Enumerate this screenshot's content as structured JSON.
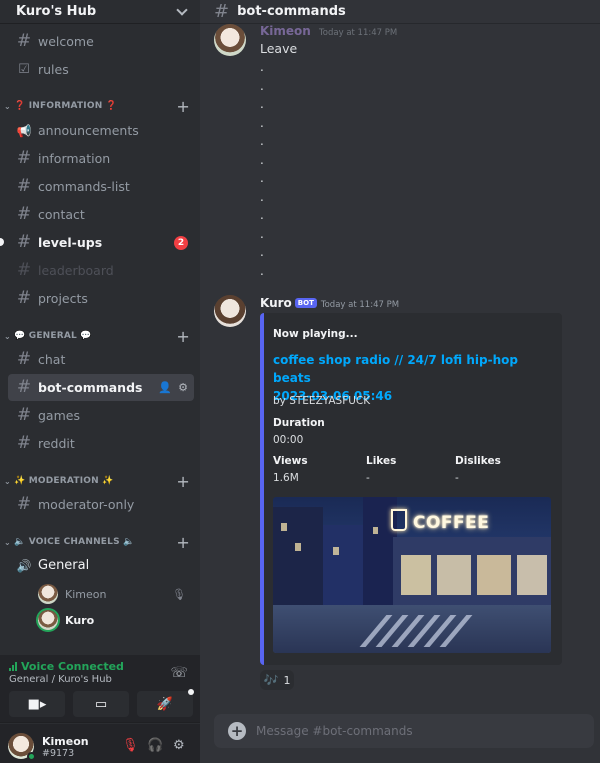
{
  "server": {
    "name": "Kuro's Hub"
  },
  "sidebar": {
    "top_channels": [
      {
        "label": "welcome"
      },
      {
        "label": "rules"
      }
    ],
    "categories": {
      "information": "❓ INFORMATION ❓",
      "general": "💬 GENERAL 💬",
      "moderation": "✨ MODERATION ✨",
      "voice": "🔈 VOICE CHANNELS 🔈"
    },
    "info_channels": [
      {
        "label": "announcements"
      },
      {
        "label": "information"
      },
      {
        "label": "commands-list"
      },
      {
        "label": "contact"
      },
      {
        "label": "level-ups",
        "badge": "2"
      },
      {
        "label": "leaderboard"
      },
      {
        "label": "projects"
      }
    ],
    "general_channels": [
      {
        "label": "chat"
      },
      {
        "label": "bot-commands"
      },
      {
        "label": "games"
      },
      {
        "label": "reddit"
      }
    ],
    "moderation_channels": [
      {
        "label": "moderator-only"
      }
    ],
    "voice_channel": {
      "label": "General"
    },
    "voice_users": [
      {
        "name": "Kimeon"
      },
      {
        "name": "Kuro"
      }
    ]
  },
  "voice_panel": {
    "status": "Voice Connected",
    "location": "General / Kuro's Hub"
  },
  "user_panel": {
    "name": "Kimeon",
    "tag": "#9173"
  },
  "channel": {
    "name": "bot-commands"
  },
  "messages": {
    "first": {
      "author": "Kimeon",
      "timestamp": "Today at 11:47 PM",
      "text": "Leave",
      "dots": [
        ".",
        ".",
        ".",
        ".",
        ".",
        ".",
        ".",
        ".",
        ".",
        ".",
        ".",
        "."
      ]
    },
    "bot": {
      "author": "Kuro",
      "bot_tag": "BOT",
      "timestamp": "Today at 11:47 PM",
      "embed": {
        "author": "Now playing...",
        "title_line1": "coffee shop radio // 24/7 lofi hip-hop beats",
        "title_line2": "2023-03-06 05:46",
        "description": "by STEEZYASFUCK",
        "duration_label": "Duration",
        "duration_value": "00:00",
        "views_label": "Views",
        "views_value": "1.6M",
        "likes_label": "Likes",
        "likes_value": "-",
        "dislikes_label": "Dislikes",
        "dislikes_value": "-",
        "image_sign": "COFFEE"
      },
      "reaction": {
        "emoji": "🎶",
        "count": "1"
      }
    }
  },
  "composer": {
    "placeholder": "Message #bot-commands"
  },
  "colors": {
    "accent": "#5865f2",
    "link": "#00a8fc",
    "online": "#23a55a",
    "badge": "#f23f43"
  }
}
